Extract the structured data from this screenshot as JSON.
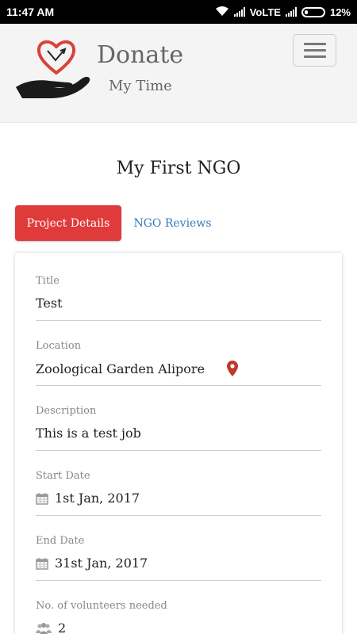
{
  "status": {
    "time": "11:47 AM",
    "network": "VoLTE",
    "battery": "12%"
  },
  "brand": {
    "title": "Donate",
    "subtitle": "My Time"
  },
  "page": {
    "title": "My First NGO"
  },
  "tabs": [
    {
      "label": "Project Details",
      "active": true
    },
    {
      "label": "NGO Reviews",
      "active": false
    }
  ],
  "details": {
    "title": {
      "label": "Title",
      "value": "Test"
    },
    "location": {
      "label": "Location",
      "value": "Zoological Garden Alipore"
    },
    "description": {
      "label": "Description",
      "value": "This is a test job"
    },
    "start_date": {
      "label": "Start Date",
      "value": "1st Jan, 2017"
    },
    "end_date": {
      "label": "End Date",
      "value": "31st Jan, 2017"
    },
    "volunteers": {
      "label": "No. of volunteers needed",
      "value": "2"
    }
  },
  "colors": {
    "accent": "#e03b3b",
    "link": "#337ab7",
    "pin": "#c0392b"
  },
  "icons": {
    "location": "map-marker-icon",
    "date": "calendar-icon",
    "volunteers": "users-icon",
    "menu": "hamburger-icon"
  }
}
